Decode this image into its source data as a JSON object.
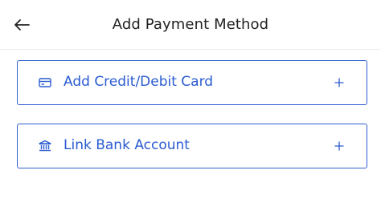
{
  "header": {
    "title": "Add Payment Method",
    "back_icon": "arrow-left-icon"
  },
  "options": [
    {
      "label": "Add Credit/Debit Card",
      "icon": "credit-card-icon",
      "action_icon": "plus-icon"
    },
    {
      "label": "Link Bank Account",
      "icon": "bank-icon",
      "action_icon": "plus-icon"
    }
  ],
  "colors": {
    "accent": "#2a5bd0",
    "border": "#2f5fce",
    "title_text": "#222222",
    "divider": "#eceef2",
    "background": "#ffffff"
  }
}
